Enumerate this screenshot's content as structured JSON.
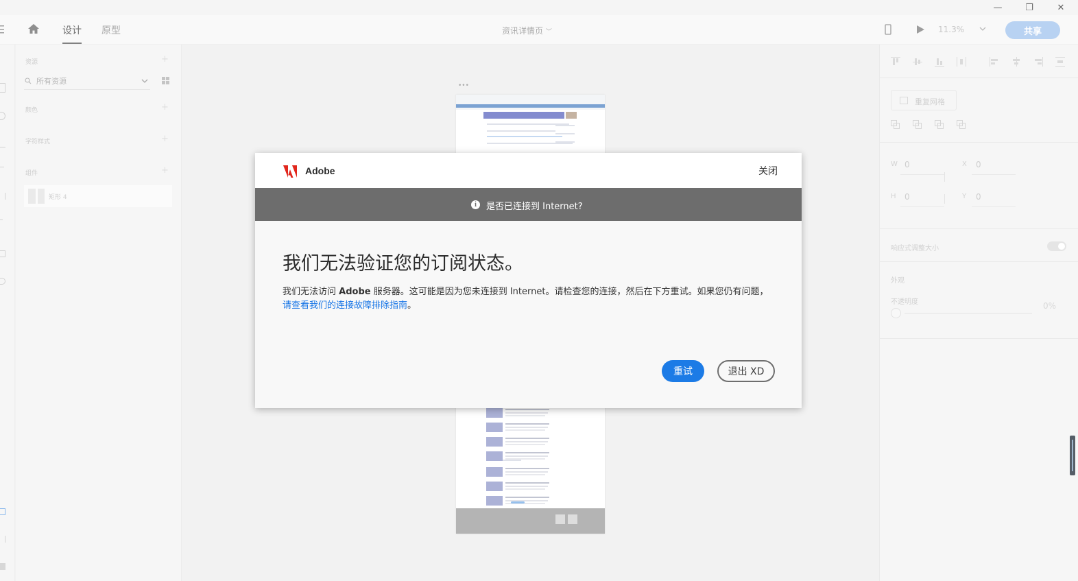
{
  "window": {
    "minimize_label": "—",
    "restore_label": "❐",
    "close_label": "✕"
  },
  "appbar": {
    "tabs": [
      {
        "label": "设计",
        "active": true
      },
      {
        "label": "原型",
        "active": false
      }
    ],
    "doc_title": "资讯详情页",
    "zoom": "11.3%",
    "share_label": "共享"
  },
  "assets": {
    "section_assets": "资源",
    "search_placeholder": "所有资源",
    "section_colors": "颜色",
    "section_char_styles": "字符样式",
    "section_components": "组件",
    "component_item": "矩形 4"
  },
  "props": {
    "repeat_grid": "重复网格",
    "w_label": "W",
    "w_value": "0",
    "x_label": "X",
    "x_value": "0",
    "h_label": "H",
    "h_value": "0",
    "y_label": "Y",
    "y_value": "0",
    "responsive_resize": "响应式调整大小",
    "appearance": "外观",
    "opacity_label": "不透明度",
    "opacity_value": "0%"
  },
  "dialog": {
    "brand": "Adobe",
    "close_label": "关闭",
    "banner_text": "是否已连接到 Internet?",
    "title": "我们无法验证您的订阅状态。",
    "body_part1": "我们无法访问 ",
    "body_bold": "Adobe",
    "body_part2": " 服务器。这可能是因为您未连接到 Internet。请检查您的连接，然后在下方重试。如果您仍有问题，",
    "body_link": "请查看我们的连接故障排除指南",
    "body_end": "。",
    "retry_label": "重试",
    "quit_label": "退出 XD",
    "brand_color": "#e1261c",
    "accent_color": "#1c7be6"
  }
}
